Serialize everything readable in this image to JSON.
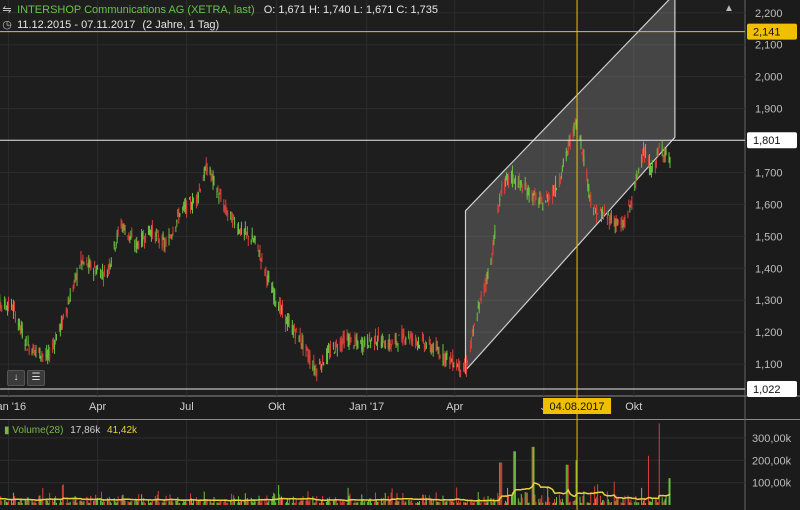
{
  "header": {
    "title": "INTERSHOP Communications AG (XETRA, last)",
    "ohlc": "O: 1,671  H: 1,740  L: 1,671  C: 1,735",
    "range": "11.12.2015 - 07.11.2017",
    "interval": "(2 Jahre, 1 Tag)"
  },
  "volume_header": {
    "name": "Volume(28)",
    "v1": "17,86k",
    "v2": "41,42k"
  },
  "colors": {
    "up": "#6ac23f",
    "down": "#d9413a",
    "sma": "#e8d23a",
    "crosshair": "#f0c000",
    "channel": "#d0d0d0",
    "background": "#1b1b1b"
  },
  "icons": [
    "chart-type-icon",
    "clock-icon",
    "arrow-down-icon",
    "stack-icon",
    "scroll-up-icon"
  ],
  "chart_data": {
    "type": "candlestick",
    "price_axis": {
      "ylim": [
        1000,
        2240
      ],
      "ticks": [
        1100,
        1200,
        1300,
        1400,
        1500,
        1600,
        1700,
        1800,
        1900,
        2000,
        2100,
        2200
      ],
      "tick_labels": [
        "1,100",
        "1,200",
        "1,300",
        "1,400",
        "1,500",
        "1,600",
        "1,700",
        "1,800",
        "1,900",
        "2,000",
        "2,100",
        "2,200"
      ]
    },
    "volume_axis": {
      "ylim": [
        0,
        380000
      ],
      "ticks": [
        100000,
        200000,
        300000
      ],
      "tick_labels": [
        "100,00k",
        "200,00k",
        "300,00k"
      ]
    },
    "x_axis": {
      "start": "2015-12-11",
      "end": "2017-11-07",
      "ticks": [
        {
          "date": "2016-01-01",
          "label": "Jan '16"
        },
        {
          "date": "2016-04-01",
          "label": "Apr"
        },
        {
          "date": "2016-07-01",
          "label": "Jul"
        },
        {
          "date": "2016-10-01",
          "label": "Okt"
        },
        {
          "date": "2017-01-01",
          "label": "Jan '17"
        },
        {
          "date": "2017-04-01",
          "label": "Apr"
        },
        {
          "date": "2017-07-01",
          "label": "J"
        },
        {
          "date": "2017-10-01",
          "label": "Okt"
        }
      ]
    },
    "anchors": [
      [
        "2015-12-11",
        1300
      ],
      [
        "2016-01-05",
        1280
      ],
      [
        "2016-01-20",
        1160
      ],
      [
        "2016-02-10",
        1120
      ],
      [
        "2016-02-25",
        1230
      ],
      [
        "2016-03-15",
        1420
      ],
      [
        "2016-04-10",
        1380
      ],
      [
        "2016-04-25",
        1540
      ],
      [
        "2016-05-10",
        1470
      ],
      [
        "2016-05-25",
        1520
      ],
      [
        "2016-06-10",
        1470
      ],
      [
        "2016-06-25",
        1580
      ],
      [
        "2016-07-10",
        1610
      ],
      [
        "2016-07-22",
        1720
      ],
      [
        "2016-08-10",
        1580
      ],
      [
        "2016-08-25",
        1520
      ],
      [
        "2016-09-10",
        1480
      ],
      [
        "2016-09-25",
        1340
      ],
      [
        "2016-10-10",
        1240
      ],
      [
        "2016-10-25",
        1180
      ],
      [
        "2016-11-10",
        1080
      ],
      [
        "2016-11-25",
        1140
      ],
      [
        "2016-12-10",
        1180
      ],
      [
        "2016-12-25",
        1160
      ],
      [
        "2017-01-10",
        1180
      ],
      [
        "2017-01-25",
        1160
      ],
      [
        "2017-02-10",
        1190
      ],
      [
        "2017-02-25",
        1170
      ],
      [
        "2017-03-10",
        1150
      ],
      [
        "2017-03-25",
        1120
      ],
      [
        "2017-04-12",
        1080
      ],
      [
        "2017-04-25",
        1270
      ],
      [
        "2017-05-08",
        1420
      ],
      [
        "2017-05-18",
        1640
      ],
      [
        "2017-05-28",
        1690
      ],
      [
        "2017-06-15",
        1640
      ],
      [
        "2017-06-30",
        1600
      ],
      [
        "2017-07-15",
        1660
      ],
      [
        "2017-08-04",
        1870
      ],
      [
        "2017-08-20",
        1580
      ],
      [
        "2017-09-05",
        1560
      ],
      [
        "2017-09-20",
        1530
      ],
      [
        "2017-09-30",
        1620
      ],
      [
        "2017-10-10",
        1770
      ],
      [
        "2017-10-20",
        1700
      ],
      [
        "2017-10-28",
        1780
      ],
      [
        "2017-11-07",
        1740
      ]
    ],
    "annotations": {
      "horizontal_lines": [
        {
          "value": 2141,
          "label": "2,141",
          "style": "crosshair"
        },
        {
          "value": 1801,
          "label": "1,801",
          "style": "white"
        },
        {
          "value": 1022,
          "label": "1,022",
          "style": "white"
        }
      ],
      "crosshair_date": {
        "date": "2017-08-04",
        "label": "04.08.2017"
      },
      "channel": {
        "lower_start": {
          "date": "2017-04-12",
          "value": 1080
        },
        "lower_end": {
          "date": "2017-11-12",
          "value": 1810
        },
        "upper_start": {
          "date": "2017-04-12",
          "value": 1580
        },
        "upper_end": {
          "date": "2017-11-12",
          "value": 2260
        }
      }
    },
    "volume_peaks": [
      {
        "date": "2017-05-18",
        "value": 190000
      },
      {
        "date": "2017-06-01",
        "value": 240000
      },
      {
        "date": "2017-06-20",
        "value": 260000
      },
      {
        "date": "2017-07-25",
        "value": 180000
      },
      {
        "date": "2017-08-04",
        "value": 200000
      },
      {
        "date": "2017-10-15",
        "value": 220000
      },
      {
        "date": "2017-10-28",
        "value": 365000
      },
      {
        "date": "2017-11-07",
        "value": 120000
      }
    ]
  }
}
